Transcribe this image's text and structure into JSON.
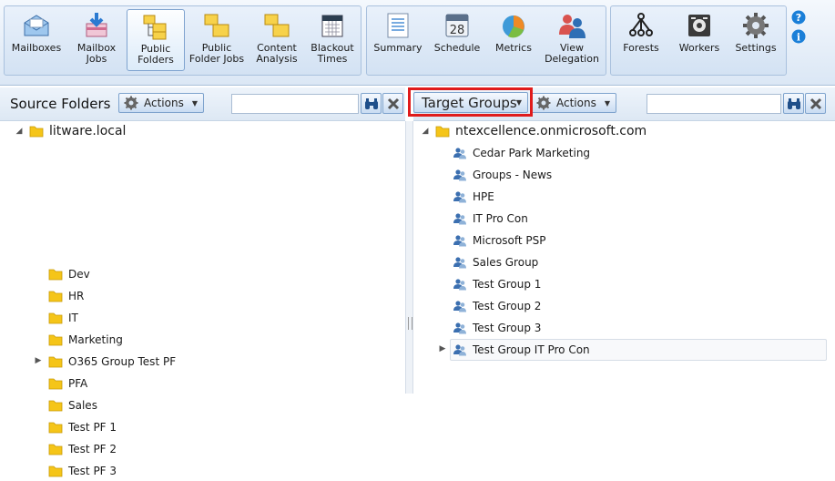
{
  "toolbar": {
    "groups": [
      {
        "buttons": [
          {
            "label": "Mailboxes",
            "icon": "mailboxes-icon"
          },
          {
            "label": "Mailbox Jobs",
            "icon": "mailbox-jobs-icon"
          },
          {
            "label": "Public Folders",
            "icon": "public-folders-icon",
            "active": true
          },
          {
            "label": "Public Folder Jobs",
            "icon": "public-folder-jobs-icon"
          },
          {
            "label": "Content Analysis",
            "icon": "content-analysis-icon"
          },
          {
            "label": "Blackout Times",
            "icon": "blackout-times-icon"
          }
        ]
      },
      {
        "buttons": [
          {
            "label": "Summary",
            "icon": "summary-icon"
          },
          {
            "label": "Schedule",
            "icon": "schedule-icon",
            "icon_text": "28"
          },
          {
            "label": "Metrics",
            "icon": "metrics-icon"
          },
          {
            "label": "View Delegation",
            "icon": "view-delegation-icon"
          }
        ]
      },
      {
        "buttons": [
          {
            "label": "Forests",
            "icon": "forests-icon"
          },
          {
            "label": "Workers",
            "icon": "workers-icon"
          },
          {
            "label": "Settings",
            "icon": "settings-icon"
          }
        ]
      }
    ],
    "help_icon": "help-icon",
    "info_icon": "info-icon"
  },
  "source_pane": {
    "title": "Source Folders",
    "actions_label": "Actions",
    "search_value": "",
    "root": {
      "label": "litware.local",
      "expanded": true
    },
    "items": [
      {
        "label": "Dev",
        "expandable": false
      },
      {
        "label": "HR",
        "expandable": false
      },
      {
        "label": "IT",
        "expandable": false
      },
      {
        "label": "Marketing",
        "expandable": false
      },
      {
        "label": "O365 Group Test PF",
        "expandable": true
      },
      {
        "label": "PFA",
        "expandable": false
      },
      {
        "label": "Sales",
        "expandable": false
      },
      {
        "label": "Test PF 1",
        "expandable": false
      },
      {
        "label": "Test PF 2",
        "expandable": false
      },
      {
        "label": "Test PF 3",
        "expandable": false
      }
    ]
  },
  "target_pane": {
    "mode_label": "Target Groups",
    "actions_label": "Actions",
    "search_value": "",
    "root": {
      "label": "ntexcellence.onmicrosoft.com",
      "expanded": true
    },
    "items": [
      {
        "label": "Cedar Park Marketing",
        "expandable": false
      },
      {
        "label": "Groups - News",
        "expandable": false
      },
      {
        "label": "HPE",
        "expandable": false
      },
      {
        "label": "IT Pro Con",
        "expandable": false
      },
      {
        "label": "Microsoft PSP",
        "expandable": false
      },
      {
        "label": "Sales Group",
        "expandable": false
      },
      {
        "label": "Test Group 1",
        "expandable": false
      },
      {
        "label": "Test Group 2",
        "expandable": false
      },
      {
        "label": "Test Group 3",
        "expandable": false
      },
      {
        "label": "Test Group IT Pro Con",
        "expandable": true,
        "selected": true
      }
    ]
  },
  "colors": {
    "highlight": "#e01b1b",
    "folder": "#f5c518",
    "accent": "#7ea3cd"
  }
}
